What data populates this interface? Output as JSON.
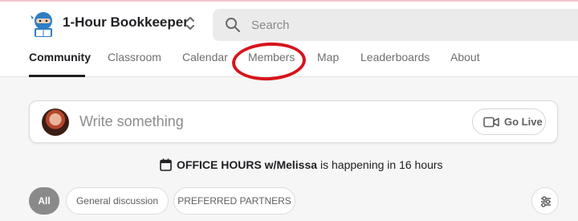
{
  "header": {
    "group_name": "1-Hour Bookkeeper",
    "search": {
      "placeholder": "Search",
      "value": ""
    }
  },
  "tabs": [
    {
      "label": "Community",
      "active": true
    },
    {
      "label": "Classroom",
      "active": false
    },
    {
      "label": "Calendar",
      "active": false
    },
    {
      "label": "Members",
      "active": false
    },
    {
      "label": "Map",
      "active": false
    },
    {
      "label": "Leaderboards",
      "active": false
    },
    {
      "label": "About",
      "active": false
    }
  ],
  "composer": {
    "placeholder_text": "Write something",
    "go_live_label": "Go Live"
  },
  "event": {
    "title": "OFFICE HOURS w/Melissa",
    "status": "is happening in 16 hours"
  },
  "filters": {
    "chips": [
      {
        "label": "All",
        "active": true
      },
      {
        "label": "General discussion",
        "active": false
      },
      {
        "label": "PREFERRED PARTNERS",
        "active": false
      }
    ]
  },
  "icons": {
    "logo": "ninja-reading-book-logo",
    "switcher": "chevron-up-down-icon",
    "search": "search-icon",
    "go_live": "video-camera-icon",
    "event": "calendar-icon",
    "filter": "sliders-icon"
  },
  "colors": {
    "annotation_ring": "#d8141b",
    "active_chip": "#8a8a8a",
    "logo_blue": "#2f7ec3"
  }
}
